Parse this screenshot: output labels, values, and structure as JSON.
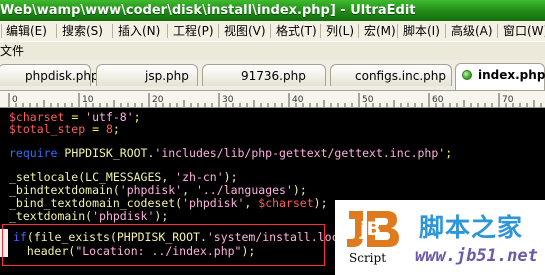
{
  "window": {
    "title": "Web\\wamp\\www\\coder\\disk\\install\\index.php] - UltraEdit",
    "title_color": "#1f8a17"
  },
  "menu": {
    "items": [
      "编辑(E)",
      "搜索(S)",
      "插入(N)",
      "工程(P)",
      "视图(V)",
      "格式(T)",
      "列(L)",
      "宏(M)",
      "脚本(I)",
      "高级(A)",
      "窗口(W)"
    ],
    "file_label": "文件"
  },
  "tabs": [
    {
      "label": "phpdisk.php",
      "active": false
    },
    {
      "label": "jsp.php",
      "active": false
    },
    {
      "label": "91736.php",
      "active": false
    },
    {
      "label": "configs.inc.php",
      "active": false
    },
    {
      "label": "index.php",
      "active": true
    }
  ],
  "ruler": {
    "labels": [
      "0",
      "10",
      "20",
      "30",
      "40",
      "50",
      "60",
      "70"
    ]
  },
  "code": {
    "lines": [
      [
        {
          "t": "$charset",
          "c": "var"
        },
        {
          "t": " = ",
          "c": "plain"
        },
        {
          "t": "'utf-8'",
          "c": "str"
        },
        {
          "t": ";",
          "c": "plain"
        }
      ],
      [
        {
          "t": "$total_step",
          "c": "var"
        },
        {
          "t": " = ",
          "c": "plain"
        },
        {
          "t": "8",
          "c": "num"
        },
        {
          "t": ";",
          "c": "plain"
        }
      ],
      [],
      [
        {
          "t": "require",
          "c": "kw"
        },
        {
          "t": " PHPDISK_ROOT.",
          "c": "fn"
        },
        {
          "t": "'includes/lib/php-gettext/gettext.inc.php'",
          "c": "str"
        },
        {
          "t": ";",
          "c": "plain"
        }
      ],
      [],
      [
        {
          "t": "_setlocale(LC_MESSAGES, ",
          "c": "fn"
        },
        {
          "t": "'zh-cn'",
          "c": "str"
        },
        {
          "t": ");",
          "c": "fn"
        }
      ],
      [
        {
          "t": "_bindtextdomain(",
          "c": "fn"
        },
        {
          "t": "'phpdisk'",
          "c": "str"
        },
        {
          "t": ", ",
          "c": "fn"
        },
        {
          "t": "'../languages'",
          "c": "str"
        },
        {
          "t": ");",
          "c": "fn"
        }
      ],
      [
        {
          "t": "_bind_textdomain_codeset(",
          "c": "fn"
        },
        {
          "t": "'phpdisk'",
          "c": "str"
        },
        {
          "t": ", ",
          "c": "fn"
        },
        {
          "t": "$charset",
          "c": "var"
        },
        {
          "t": ");",
          "c": "fn"
        }
      ],
      [
        {
          "t": "_textdomain(",
          "c": "fn"
        },
        {
          "t": "'phpdisk'",
          "c": "str"
        },
        {
          "t": ");",
          "c": "fn"
        }
      ],
      [],
      [
        {
          "t": "if",
          "c": "kw"
        },
        {
          "t": "(file_exists(PHPDISK_ROOT.",
          "c": "fn"
        },
        {
          "t": "'system/install.lock'",
          "c": "str"
        },
        {
          "t": ")){",
          "c": "fn"
        }
      ],
      [
        {
          "t": "  header(",
          "c": "fn"
        },
        {
          "t": "\"Location: ../index.php\"",
          "c": "str"
        },
        {
          "t": ");",
          "c": "fn"
        }
      ]
    ]
  },
  "watermark": {
    "logo_text": "jB",
    "title": "脚本之家",
    "script_label": "Script",
    "domain": "www.jb51.net"
  },
  "colors": {
    "background": "#000000",
    "variable": "#ff5c5c",
    "string": "#ffb0e0",
    "keyword": "#2f6cff",
    "function": "#f2f2a8",
    "selection_border": "#ff3030"
  }
}
